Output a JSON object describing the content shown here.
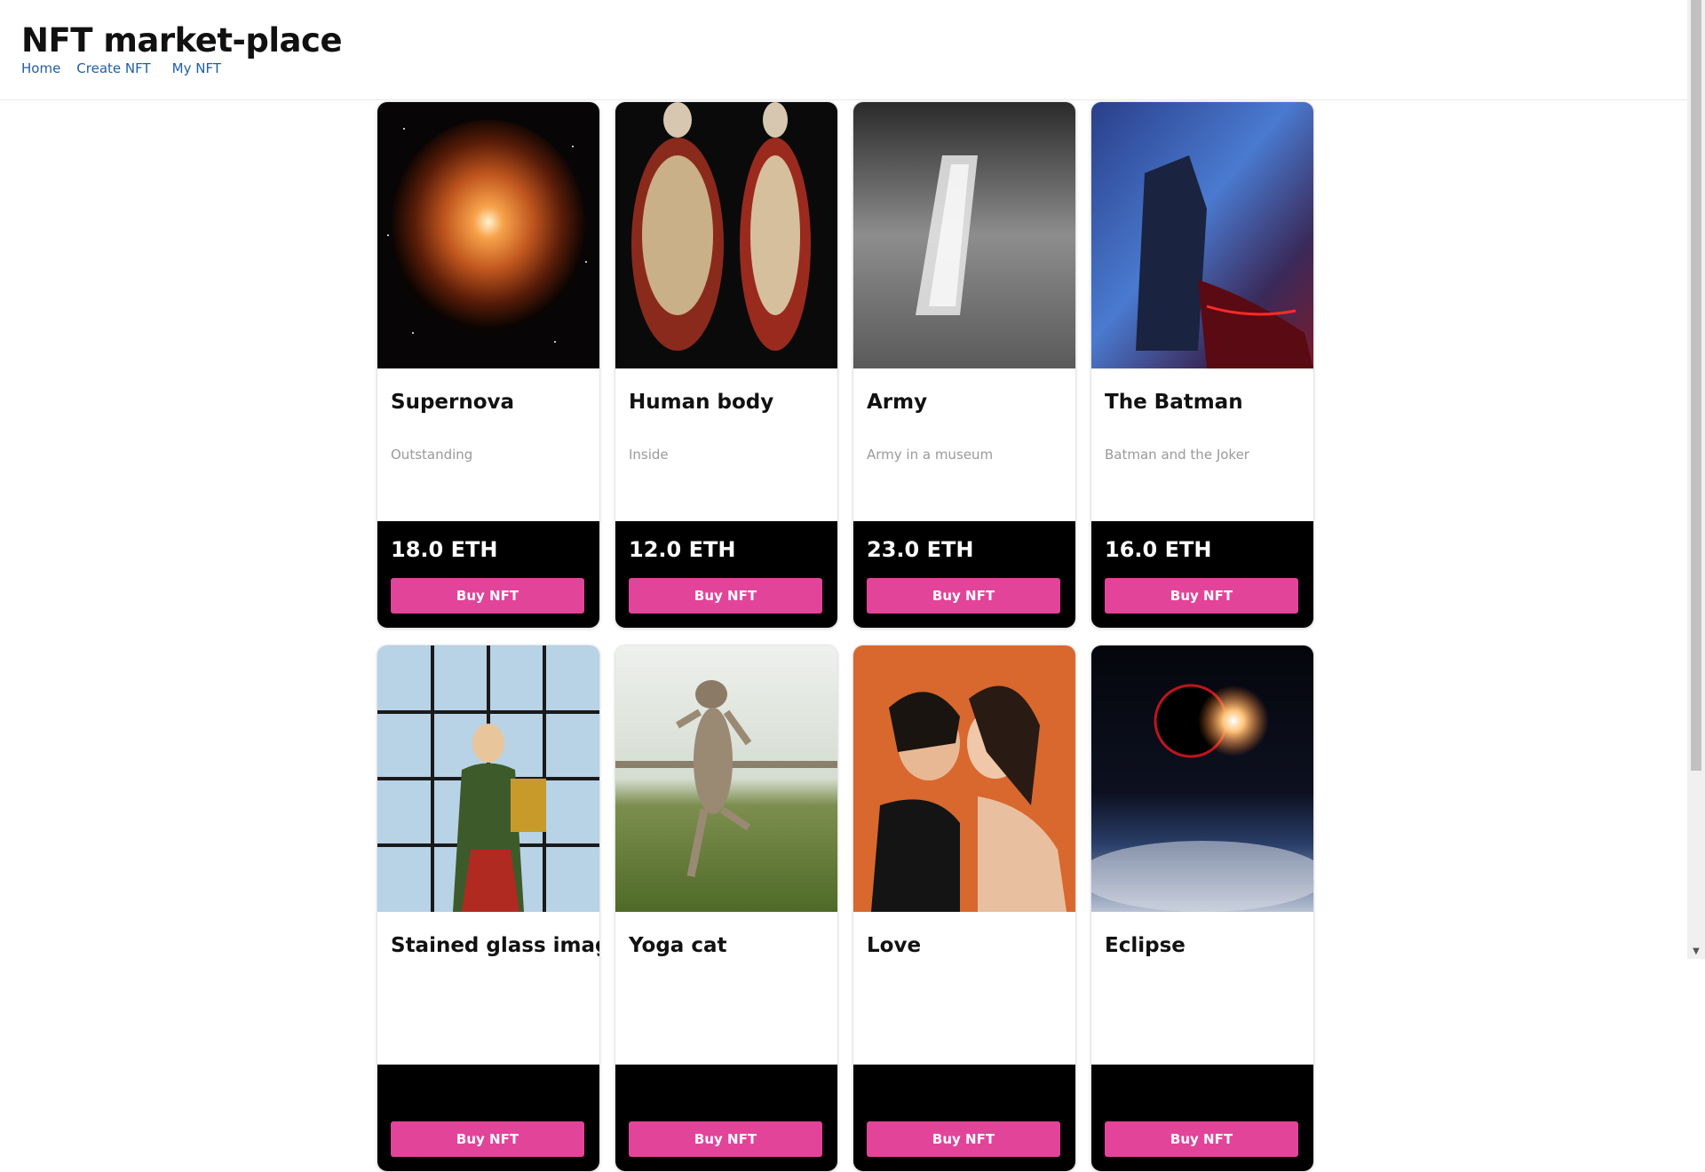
{
  "header": {
    "title": "NFT market-place",
    "nav": [
      {
        "label": "Home"
      },
      {
        "label": "Create NFT"
      },
      {
        "label": "My NFT"
      }
    ]
  },
  "colors": {
    "accent": "#e2449a",
    "footer_bg": "#000000",
    "link": "#1f5ea8",
    "muted_text": "#9a9a9a"
  },
  "items": [
    {
      "name": "Supernova",
      "description": "Outstanding",
      "price": "18.0 ETH",
      "button": "Buy NFT",
      "image": "supernova-image"
    },
    {
      "name": "Human body",
      "description": "Inside",
      "price": "12.0 ETH",
      "button": "Buy NFT",
      "image": "human-body-image"
    },
    {
      "name": "Army",
      "description": "Army in a museum",
      "price": "23.0 ETH",
      "button": "Buy NFT",
      "image": "army-image"
    },
    {
      "name": "The Batman",
      "description": "Batman and the Joker",
      "price": "16.0 ETH",
      "button": "Buy NFT",
      "image": "batman-image"
    },
    {
      "name": "Stained glass image",
      "description": "",
      "price": "",
      "button": "Buy NFT",
      "image": "stained-glass-image"
    },
    {
      "name": "Yoga cat",
      "description": "",
      "price": "",
      "button": "Buy NFT",
      "image": "yoga-cat-image"
    },
    {
      "name": "Love",
      "description": "",
      "price": "",
      "button": "Buy NFT",
      "image": "love-image"
    },
    {
      "name": "Eclipse",
      "description": "",
      "price": "",
      "button": "Buy NFT",
      "image": "eclipse-image"
    }
  ]
}
